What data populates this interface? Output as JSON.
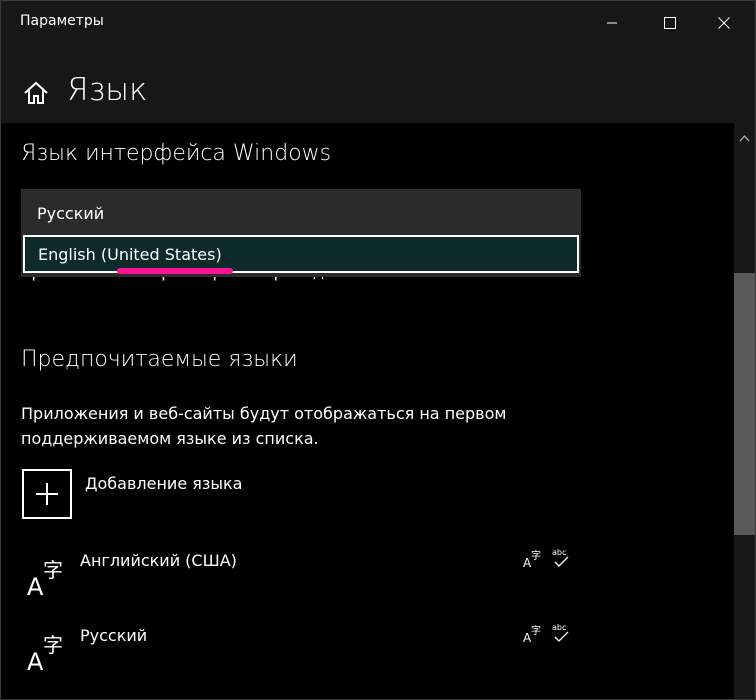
{
  "window": {
    "title": "Параметры"
  },
  "header": {
    "title": "Язык"
  },
  "interface_language": {
    "section_title": "Язык интерфейса Windows",
    "options": [
      "Русский",
      "English (United States)"
    ],
    "highlighted_option": "English (United States)",
    "partial_text": "приложение \"Параметры\" и проводник."
  },
  "preferred_languages": {
    "section_title": "Предпочитаемые языки",
    "description": "Приложения и веб-сайты будут отображаться на первом поддерживаемом языке из списка.",
    "add_label": "Добавление языка",
    "languages": [
      {
        "name": "Английский (США)"
      },
      {
        "name": "Русский"
      }
    ]
  },
  "colors": {
    "accent_underline": "#ff1493",
    "selected_option_bg": "#0e2a2a"
  }
}
